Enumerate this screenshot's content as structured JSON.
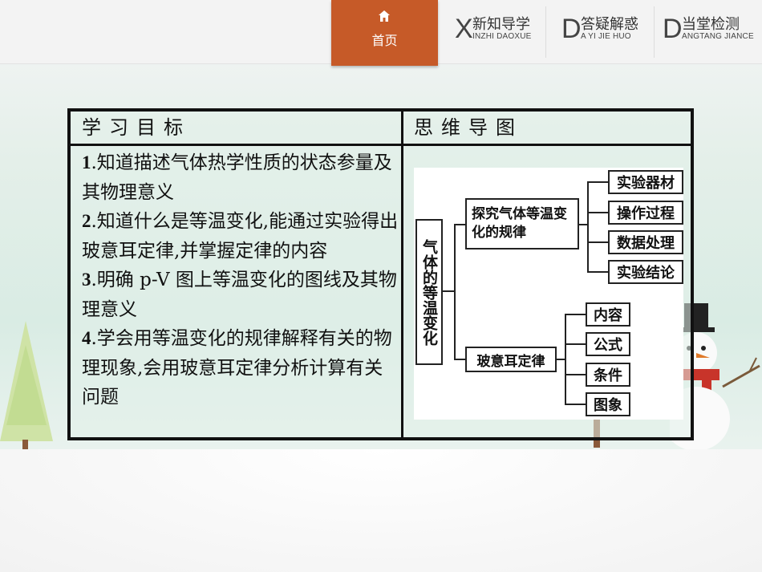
{
  "nav": {
    "home_label": "首页",
    "items": [
      {
        "letter": "X",
        "cn": "新知导学",
        "pinyin": "INZHI DAOXUE"
      },
      {
        "letter": "D",
        "cn": "答疑解惑",
        "pinyin": "A YI JIE HUO"
      },
      {
        "letter": "D",
        "cn": "当堂检测",
        "pinyin": "ANGTANG JIANCE"
      }
    ],
    "accent": "#c65a28"
  },
  "table": {
    "left_header": "学习目标",
    "right_header": "思维导图",
    "goals": [
      {
        "num": "1",
        "text": ".知道描述气体热学性质的状态参量及其物理意义"
      },
      {
        "num": "2",
        "text": ".知道什么是等温变化,能通过实验得出玻意耳定律,并掌握定律的内容"
      },
      {
        "num": "3",
        "text": ".明确 p-V 图上等温变化的图线及其物理意义"
      },
      {
        "num": "4",
        "text": ".学会用等温变化的规律解释有关的物理现象,会用玻意耳定律分析计算有关问题"
      }
    ]
  },
  "mindmap": {
    "root": "气体的等温变化",
    "branch1": "探究气体等温变化的规律",
    "branch1_leaves": [
      "实验器材",
      "操作过程",
      "数据处理",
      "实验结论"
    ],
    "branch2": "玻意耳定律",
    "branch2_leaves": [
      "内容",
      "公式",
      "条件",
      "图象"
    ]
  }
}
